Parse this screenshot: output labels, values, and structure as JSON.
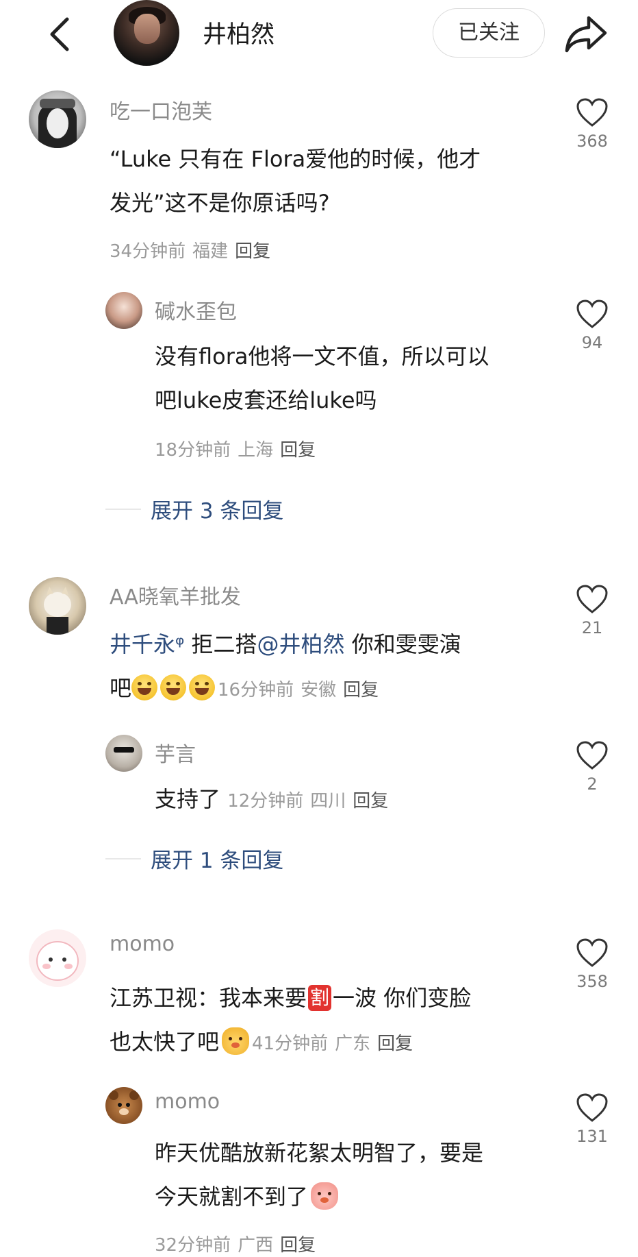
{
  "header": {
    "title": "井柏然",
    "follow_label": "已关注"
  },
  "icons": {
    "back": "chevron-left-icon",
    "share": "share-arrow-icon",
    "like": "heart-outline-icon"
  },
  "thread1": {
    "main": {
      "username": "吃一口泡芙",
      "text_line1": "“Luke 只有在 Flora爱他的时候，他才",
      "text_line2": "发光”这不是你原话吗?",
      "time": "34分钟前",
      "location": "福建",
      "reply_label": "回复",
      "likes": "368"
    },
    "reply": {
      "username": "碱水歪包",
      "text_line1": "没有flora他将一文不值，所以可以",
      "text_line2": "吧luke皮套还给luke吗",
      "time": "18分钟前",
      "location": "上海",
      "reply_label": "回复",
      "likes": "94"
    },
    "expand_label": "展开 3 条回复"
  },
  "thread2": {
    "main": {
      "username": "AA晓氧羊批发",
      "mention": "井千永ᵠ",
      "text_part": " 拒二搭",
      "mention2": "@井柏然",
      "text_part2": " 你和雯雯演",
      "text_line2": "吧",
      "time": "16分钟前",
      "location": "安徽",
      "reply_label": "回复",
      "likes": "21"
    },
    "reply": {
      "username": "芋言",
      "text": "支持了",
      "time": "12分钟前",
      "location": "四川",
      "reply_label": "回复",
      "likes": "2"
    },
    "expand_label": "展开 1 条回复"
  },
  "thread3": {
    "main": {
      "username": "momo",
      "text_part1": "江苏卫视：我本来要",
      "badge": "割",
      "text_part2": "一波 你们变脸",
      "text_line2": "也太快了吧",
      "time": "41分钟前",
      "location": "广东",
      "reply_label": "回复",
      "likes": "358"
    },
    "reply": {
      "username": "momo",
      "text_line1": "昨天优酷放新花絮太明智了，要是",
      "text_line2": "今天就割不到了",
      "time": "32分钟前",
      "location": "广西",
      "reply_label": "回复",
      "likes": "131"
    }
  }
}
